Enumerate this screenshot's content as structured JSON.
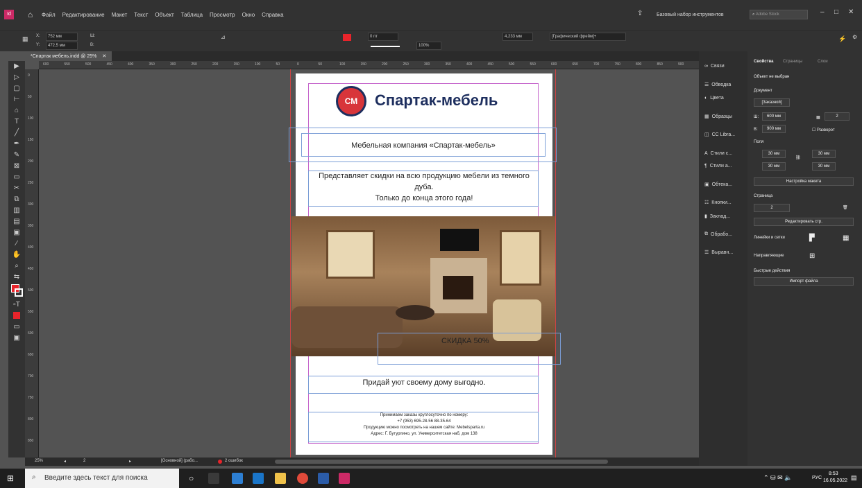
{
  "menu": [
    "Файл",
    "Редактирование",
    "Макет",
    "Текст",
    "Объект",
    "Таблица",
    "Просмотр",
    "Окно",
    "Справка"
  ],
  "workspace": "Базовый набор инструментов",
  "search_placeholder": "Adobe Stock",
  "control": {
    "x": "752 мм",
    "y": "472,5 мм",
    "stroke": "0 пт",
    "zoom_pct": "100%",
    "measure": "4,233 мм",
    "frame_type": "[Графический фрейм]+"
  },
  "doc_tab": "*Спартак мебель.indd @ 25%",
  "ruler_h": [
    "600",
    "550",
    "500",
    "450",
    "400",
    "350",
    "300",
    "250",
    "200",
    "150",
    "100",
    "50",
    "0",
    "50",
    "100",
    "150",
    "200",
    "250",
    "300",
    "350",
    "400",
    "450",
    "500",
    "550",
    "600",
    "650",
    "700",
    "750",
    "800",
    "850",
    "900"
  ],
  "page": {
    "brand": "Спартак-мебель",
    "logo_letter": "СМ",
    "company": "Мебельная компания «Спартак-мебель»",
    "promo": [
      "Представляет скидки на всю продукцию мебели из темного",
      "дуба.",
      "Только до конца этого года!"
    ],
    "discount": "СКИДКА 50%",
    "slogan": "Придай уют своему дому выгодно.",
    "contacts": [
      "Принимаем заказы круглосуточно по номеру:",
      "+7 (953) 695-28-56  88-35-64",
      "Продукцию можно посмотреть на нашем сайте: Mebelsparta.ru",
      "Адрес: Г. Бутурлино, ул. Университетская наб, дом 138"
    ]
  },
  "status": {
    "zoom": "25%",
    "page": "2",
    "master": "[Основной] (рабо...",
    "errors": "2 ошибок"
  },
  "panel_icons": [
    "Связи",
    "Обводка",
    "Цвета",
    "Образцы",
    "CC Libra...",
    "Стили с...",
    "Стили а...",
    "Обтека...",
    "Кнопки...",
    "Заклад...",
    "Обрабо...",
    "Выравн..."
  ],
  "props": {
    "tabs": [
      "Свойства",
      "Страницы",
      "Слои"
    ],
    "no_selection": "Объект не выбран",
    "document": "Документ",
    "preset": "[Заказной]",
    "width": "600 мм",
    "height": "900 мм",
    "pages": "2",
    "facing": "Разворот",
    "margins": "Поля",
    "margin_vals": [
      "30 мм",
      "30 мм",
      "30 мм",
      "30 мм"
    ],
    "adjust_layout": "Настройка макета",
    "page_label": "Страница",
    "page_val": "2",
    "edit_page": "Редактировать стр.",
    "rulers_grids": "Линейки и сетки",
    "guides": "Направляющие",
    "quick_actions": "Быстрые действия",
    "import_file": "Импорт файла"
  },
  "taskbar": {
    "search": "Введите здесь текст для поиска",
    "time": "8:53",
    "date": "16.05.2022",
    "lang": "РУС"
  },
  "colors": {
    "accent": "#e8242b",
    "brand_blue": "#1d2e5e",
    "panel": "#323232"
  }
}
